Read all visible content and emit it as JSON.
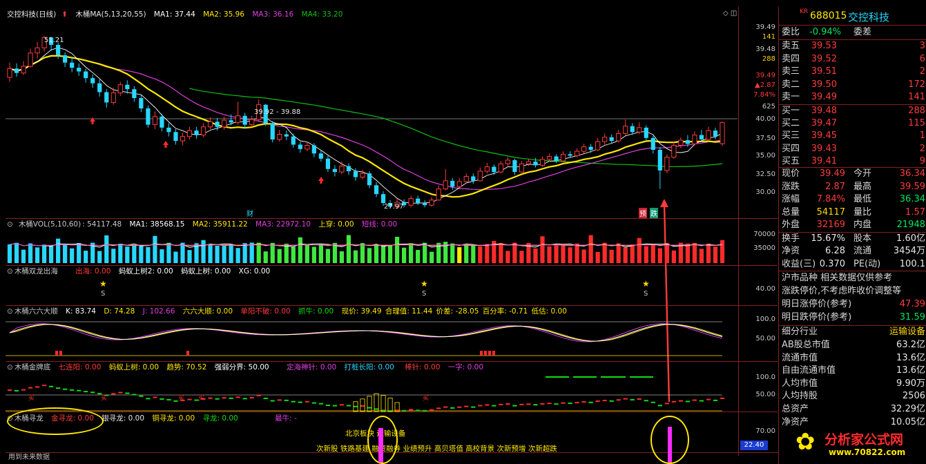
{
  "title_bar": {
    "stock_label": "交控科技(日线)",
    "ma_label": "木桶MA(5,13,20,55)",
    "ma1": "MA1: 37.44",
    "ma2": "MA2: 35.96",
    "ma3": "MA3: 36.16",
    "ma4": "MA4: 33.20"
  },
  "main_annotations": {
    "high_label": "51.21",
    "range_label": "39.92 - 39.88",
    "low_label": "27.97",
    "cai_label": "财",
    "yu_label": "预",
    "die_label": "跌"
  },
  "main_axis": {
    "top_value": "39.49",
    "top_sub": "141",
    "price2": "39.48",
    "vol2": "288",
    "last_price": "39.49",
    "change": "▲2.87",
    "change_pct": "7.84%",
    "vol3": "625",
    "ticks": [
      "40.00",
      "37.50",
      "35.00",
      "32.50",
      "30.00"
    ]
  },
  "vol_panel": {
    "header_name": "木桶VOL(5,10,60)",
    "vol": ": 54117.48",
    "ma1": "MA1: 38568.15",
    "ma2": "MA2: 35911.22",
    "ma3": "MA3: 22972.10",
    "shangchuan": "上穿: 0.00",
    "duanxian": "短线: 0.00",
    "ticks": [
      "70000",
      "35000"
    ]
  },
  "shuanglong_panel": {
    "header_name": "木桶双龙出海",
    "chuhai": "出海: 0.00",
    "mayi2": "蚂蚁上树2: 0.00",
    "mayi": "蚂蚁上树: 0.00",
    "xg": "XG: 0.00",
    "star_label": "S",
    "tick": "40.00"
  },
  "liuliu_panel": {
    "header_name": "木桶六六大顺",
    "k": "K: 83.74",
    "d": "D: 74.28",
    "j": "J: 102.66",
    "liuliu": "六六大顺: 0.00",
    "danyang": "单阳不破: 0.00",
    "zhuaniu": "抓牛: 0.00",
    "xianjia": "现价: 39.49",
    "helizhi": "合理值: 11.44",
    "jiacha": "价差: -28.05",
    "baifenlv": "百分率: -0.71",
    "digu": "低估: 0.00",
    "ticks": [
      "100.0",
      "50.00"
    ]
  },
  "jinpai_panel": {
    "header_name": "木桶金牌底",
    "qilianyang": "七连阳: 0.00",
    "mayi": "蚂蚁上树: 0.00",
    "qushi": "趋势: 70.52",
    "qiangruo": "强弱分界: 50.00",
    "dinghai": "定海神针: 0.00",
    "dapo": "打桩长阳: 0.00",
    "bangzhen": "棒针: 0.00",
    "yizi": "一字: 0.00",
    "mai_label": "买",
    "ticks": [
      "100.0",
      "50.00"
    ]
  },
  "xunlong_panel": {
    "header_name": "木桶寻龙",
    "jin": "金寻龙: 0.00",
    "yin": "银寻龙: 0.00",
    "tong": "铜寻龙: 0.00",
    "xun": "寻龙: 0.00",
    "zuiniu": "最牛: -",
    "sector_line": "北京板块 运输设备",
    "concepts": "次新股 铁路基建 融资融券 业绩预升 高贝塔值 高校背景 次新预增 次新超跌",
    "tick": "70.00",
    "cursor_value": "22.40",
    "footer_left": "用到未来数据"
  },
  "quote": {
    "market": "KR",
    "code": "688015",
    "name": "交控科技",
    "weibi_label": "委比",
    "weibi_value": "-0.94%",
    "weicha_label": "委差",
    "sell": [
      {
        "label": "卖五",
        "price": "39.53",
        "vol": "3"
      },
      {
        "label": "卖四",
        "price": "39.52",
        "vol": "6"
      },
      {
        "label": "卖三",
        "price": "39.51",
        "vol": "2"
      },
      {
        "label": "卖二",
        "price": "39.50",
        "vol": "172"
      },
      {
        "label": "卖一",
        "price": "39.49",
        "vol": "141"
      }
    ],
    "buy": [
      {
        "label": "买一",
        "price": "39.48",
        "vol": "288"
      },
      {
        "label": "买二",
        "price": "39.47",
        "vol": "115"
      },
      {
        "label": "买三",
        "price": "39.45",
        "vol": "1"
      },
      {
        "label": "买四",
        "price": "39.43",
        "vol": "2"
      },
      {
        "label": "买五",
        "price": "39.41",
        "vol": "9"
      }
    ],
    "stats": [
      {
        "k": "现价",
        "v": "39.49",
        "k2": "今开",
        "v2": "36.34"
      },
      {
        "k": "涨跌",
        "v": "2.87",
        "k2": "最高",
        "v2": "39.59"
      },
      {
        "k": "涨幅",
        "v": "7.84%",
        "k2": "最低",
        "v2": "36.34"
      },
      {
        "k": "总量",
        "v": "54117",
        "k2": "量比",
        "v2": "1.57"
      },
      {
        "k": "外盘",
        "v": "32169",
        "k2": "内盘",
        "v2": "21948"
      }
    ],
    "stats2": [
      {
        "k": "换手",
        "v": "15.67%",
        "k2": "股本",
        "v2": "1.60亿"
      },
      {
        "k": "净资",
        "v": "6.28",
        "k2": "流通",
        "v2": "3454万"
      },
      {
        "k": "收益(三)",
        "v": "0.370",
        "k2": "PE(动)",
        "v2": "100.1"
      }
    ],
    "hs_title": "沪市品种  相关数据仅供参考",
    "zt_note": "涨跌停价,不考虑昨收价调整等",
    "zt_label": "明日涨停价(参考)",
    "zt_value": "47.39",
    "dt_label": "明日跌停价(参考)",
    "dt_value": "31.59",
    "industry_label": "细分行业",
    "industry_value": "运输设备",
    "fin": [
      {
        "k": "AB股总市值",
        "v": "63.2亿"
      },
      {
        "k": "流通市值",
        "v": "13.6亿"
      },
      {
        "k": "自由流通市值",
        "v": "13.6亿"
      },
      {
        "k": "人均市值",
        "v": "9.90万"
      },
      {
        "k": "人均持股",
        "v": "2506"
      },
      {
        "k": "总资产",
        "v": "32.29亿"
      },
      {
        "k": "净资产",
        "v": "10.05亿"
      }
    ],
    "watermark": "分析家公式网",
    "watermark_url": "www.70822.com"
  },
  "colors": {
    "up": "#ff3b3b",
    "down": "#28d7ff",
    "ma1": "#ffffff",
    "ma2": "#ffe900",
    "ma3": "#e040e0",
    "ma4": "#10c010",
    "grid": "#8a1f1f"
  },
  "chart_data": {
    "type": "candlestick",
    "price_axis": [
      27.5,
      52
    ],
    "candles": [
      [
        45.6,
        46.8,
        47.6,
        45.0
      ],
      [
        46.8,
        46.2,
        47.5,
        45.7
      ],
      [
        46.2,
        47.1,
        47.8,
        45.9
      ],
      [
        47.1,
        48.9,
        49.5,
        46.9
      ],
      [
        48.9,
        49.6,
        50.4,
        48.2
      ],
      [
        49.6,
        51.0,
        51.21,
        49.1
      ],
      [
        51.0,
        50.0,
        51.1,
        49.2
      ],
      [
        50.0,
        48.6,
        50.3,
        48.1
      ],
      [
        48.6,
        47.6,
        49.0,
        47.0
      ],
      [
        47.6,
        46.9,
        48.4,
        46.3
      ],
      [
        46.9,
        46.4,
        47.5,
        45.8
      ],
      [
        46.4,
        45.5,
        46.8,
        44.9
      ],
      [
        45.5,
        44.8,
        46.0,
        44.2
      ],
      [
        44.8,
        43.6,
        45.3,
        43.0
      ],
      [
        43.6,
        42.2,
        44.0,
        41.5
      ],
      [
        42.2,
        43.5,
        44.2,
        41.9
      ],
      [
        43.5,
        44.6,
        45.0,
        43.1
      ],
      [
        44.6,
        44.0,
        45.2,
        43.4
      ],
      [
        44.0,
        42.8,
        44.4,
        42.3
      ],
      [
        42.8,
        41.4,
        43.2,
        40.9
      ],
      [
        41.4,
        39.2,
        41.8,
        38.8
      ],
      [
        39.2,
        40.3,
        41.0,
        38.6
      ],
      [
        40.3,
        38.8,
        40.7,
        38.3
      ],
      [
        38.8,
        38.2,
        39.4,
        37.6
      ],
      [
        38.2,
        37.0,
        38.6,
        36.5
      ],
      [
        37.0,
        37.6,
        38.1,
        36.4
      ],
      [
        37.6,
        38.4,
        38.9,
        37.2
      ],
      [
        38.4,
        37.8,
        38.9,
        37.3
      ],
      [
        37.8,
        38.9,
        39.4,
        37.5
      ],
      [
        38.9,
        39.6,
        40.2,
        38.6
      ],
      [
        39.6,
        38.9,
        40.1,
        38.4
      ],
      [
        38.9,
        39.8,
        40.3,
        38.5
      ],
      [
        39.8,
        39.5,
        40.6,
        39.1
      ],
      [
        39.5,
        40.4,
        42.3,
        39.2
      ],
      [
        40.4,
        39.2,
        40.8,
        38.7
      ],
      [
        39.2,
        39.9,
        40.4,
        38.9
      ],
      [
        39.9,
        41.9,
        42.6,
        39.7
      ],
      [
        41.9,
        39.4,
        42.0,
        39.0
      ],
      [
        39.4,
        37.2,
        39.7,
        36.8
      ],
      [
        37.2,
        37.9,
        38.5,
        36.9
      ],
      [
        37.9,
        37.6,
        38.4,
        37.1
      ],
      [
        37.6,
        36.5,
        38.0,
        36.1
      ],
      [
        36.5,
        35.9,
        36.9,
        35.4
      ],
      [
        35.9,
        36.4,
        36.9,
        35.6
      ],
      [
        36.4,
        35.3,
        36.7,
        34.8
      ],
      [
        35.3,
        34.6,
        35.7,
        34.2
      ],
      [
        34.6,
        33.2,
        35.0,
        32.8
      ],
      [
        33.2,
        32.8,
        33.7,
        32.2
      ],
      [
        32.8,
        33.6,
        34.2,
        32.5
      ],
      [
        33.6,
        32.9,
        34.0,
        32.4
      ],
      [
        32.9,
        32.1,
        33.3,
        31.6
      ],
      [
        32.1,
        32.6,
        33.1,
        31.8
      ],
      [
        32.6,
        31.0,
        32.9,
        30.6
      ],
      [
        31.0,
        29.8,
        31.4,
        29.4
      ],
      [
        29.8,
        28.6,
        30.2,
        28.2
      ],
      [
        28.6,
        28.1,
        29.0,
        27.97
      ],
      [
        28.1,
        28.7,
        29.2,
        27.97
      ],
      [
        28.7,
        28.3,
        29.1,
        28.0
      ],
      [
        28.3,
        29.2,
        29.6,
        28.0
      ],
      [
        29.2,
        28.6,
        29.6,
        28.3
      ],
      [
        28.6,
        28.3,
        29.0,
        28.0
      ],
      [
        28.3,
        29.0,
        29.4,
        28.1
      ],
      [
        29.0,
        30.5,
        31.0,
        28.9
      ],
      [
        30.5,
        31.6,
        33.2,
        30.3
      ],
      [
        31.6,
        30.8,
        32.0,
        30.4
      ],
      [
        30.8,
        31.5,
        32.0,
        30.6
      ],
      [
        31.5,
        32.2,
        32.6,
        31.3
      ],
      [
        32.2,
        31.6,
        32.6,
        31.2
      ],
      [
        31.6,
        32.9,
        33.4,
        31.5
      ],
      [
        32.9,
        33.5,
        34.0,
        32.6
      ],
      [
        33.5,
        32.8,
        33.8,
        32.4
      ],
      [
        32.8,
        33.9,
        34.3,
        32.6
      ],
      [
        33.9,
        34.4,
        34.8,
        33.5
      ],
      [
        34.4,
        32.8,
        34.6,
        32.4
      ],
      [
        32.8,
        33.9,
        34.3,
        32.7
      ],
      [
        33.9,
        34.2,
        34.6,
        33.6
      ],
      [
        34.2,
        33.7,
        34.7,
        33.4
      ],
      [
        33.7,
        34.5,
        34.9,
        33.5
      ],
      [
        34.5,
        34.9,
        35.3,
        34.2
      ],
      [
        34.9,
        34.3,
        35.2,
        34.0
      ],
      [
        34.3,
        35.2,
        35.6,
        34.1
      ],
      [
        35.2,
        35.0,
        35.6,
        34.7
      ],
      [
        35.0,
        35.6,
        36.0,
        34.8
      ],
      [
        35.6,
        36.2,
        36.6,
        35.3
      ],
      [
        36.2,
        35.8,
        36.6,
        35.4
      ],
      [
        35.8,
        36.9,
        37.4,
        35.6
      ],
      [
        36.9,
        37.5,
        38.0,
        36.5
      ],
      [
        37.5,
        37.0,
        37.9,
        36.6
      ],
      [
        37.0,
        38.0,
        38.5,
        36.8
      ],
      [
        38.0,
        39.0,
        39.9,
        37.8
      ],
      [
        39.0,
        38.2,
        39.4,
        37.8
      ],
      [
        38.2,
        38.8,
        39.5,
        37.9
      ],
      [
        38.8,
        37.4,
        39.1,
        37.0
      ],
      [
        37.4,
        35.8,
        37.7,
        35.3
      ],
      [
        35.8,
        33.0,
        36.2,
        30.5
      ],
      [
        33.0,
        34.8,
        35.2,
        32.6
      ],
      [
        34.8,
        36.4,
        36.9,
        34.6
      ],
      [
        36.4,
        37.1,
        37.5,
        36.0
      ],
      [
        37.1,
        36.6,
        37.8,
        36.2
      ],
      [
        36.6,
        37.8,
        38.3,
        36.4
      ],
      [
        37.8,
        37.2,
        38.5,
        36.9
      ],
      [
        37.2,
        38.4,
        38.9,
        37.0
      ],
      [
        38.4,
        37.6,
        38.8,
        37.2
      ],
      [
        36.62,
        39.49,
        39.59,
        36.34
      ]
    ]
  }
}
